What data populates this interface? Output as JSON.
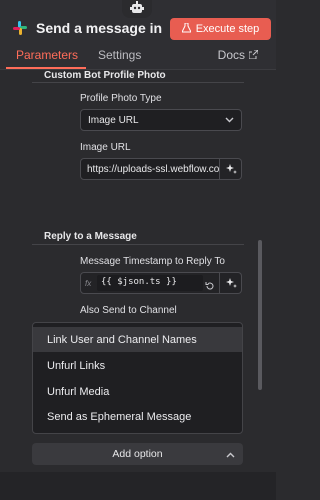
{
  "header": {
    "title": "Send a message in ...",
    "execute_label": "Execute step"
  },
  "tabs": [
    {
      "label": "Parameters"
    },
    {
      "label": "Settings"
    }
  ],
  "docs_label": "Docs",
  "sections": {
    "profile_photo": {
      "heading": "Custom Bot Profile Photo",
      "photo_type_label": "Profile Photo Type",
      "photo_type_value": "Image URL",
      "image_url_label": "Image URL",
      "image_url_value": "https://uploads-ssl.webflow.com"
    },
    "reply": {
      "heading": "Reply to a Message",
      "timestamp_label": "Message Timestamp to Reply To",
      "timestamp_fx": "fx",
      "timestamp_value": "{{ $json.ts }}",
      "also_send_label": "Also Send to Channel"
    }
  },
  "dropdown": {
    "items": [
      {
        "label": "Link User and Channel Names"
      },
      {
        "label": "Unfurl Links"
      },
      {
        "label": "Unfurl Media"
      },
      {
        "label": "Send as Ephemeral Message"
      }
    ]
  },
  "add_option_label": "Add option",
  "colors": {
    "accent": "#ff6d5a",
    "execute_bg": "#e85d51",
    "background": "#2b2b2e"
  },
  "icons": [
    "robot-icon",
    "slack-icon",
    "flask-icon",
    "external-link-icon",
    "chevron-down-icon",
    "sparkle-icon",
    "reset-icon",
    "chevron-up-icon"
  ]
}
